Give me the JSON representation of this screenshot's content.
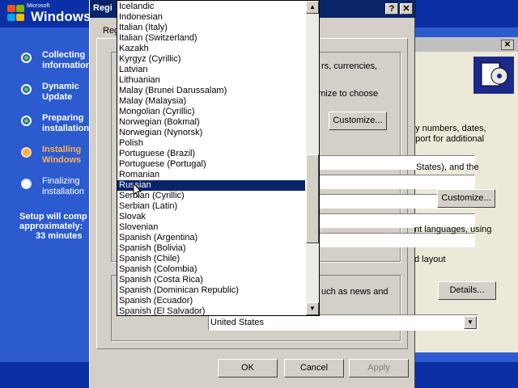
{
  "setup": {
    "logo_small": "Microsoft",
    "logo_text": "Windows",
    "steps": [
      {
        "label": "Collecting\ninformation",
        "state": "done"
      },
      {
        "label": "Dynamic\nUpdate",
        "state": "done"
      },
      {
        "label": "Preparing\ninstallation",
        "state": "done"
      },
      {
        "label": "Installing\nWindows",
        "state": "active"
      },
      {
        "label": "Finalizing\ninstallation",
        "state": "pending"
      }
    ],
    "time_line1": "Setup will comp",
    "time_line2": "approximately:",
    "time_line3": "33 minutes"
  },
  "dialog": {
    "title": "Regi",
    "tab_label": "Reg",
    "text_currencies": "rs, currencies,",
    "text_customize_to_choose": "omize to choose",
    "customize_button_1": "Customize...",
    "text_states": "States), and the",
    "text_languages_using": "nt languages, using",
    "text_layout": "d layout",
    "text_news": "uch as news and",
    "customize_button_2": "Customize...",
    "details_button": "Details...",
    "ok_button": "OK",
    "cancel_button": "Cancel",
    "apply_button": "Apply",
    "location_value": "United States"
  },
  "right_window": {
    "text_numbers": "ay numbers, dates,",
    "text_support": "pport for additional",
    "close_glyph": "✕"
  },
  "dropdown": {
    "items": [
      "Icelandic",
      "Indonesian",
      "Italian (Italy)",
      "Italian (Switzerland)",
      "Kazakh",
      "Kyrgyz (Cyrillic)",
      "Latvian",
      "Lithuanian",
      "Malay (Brunei Darussalam)",
      "Malay (Malaysia)",
      "Mongolian (Cyrillic)",
      "Norwegian (Bokmal)",
      "Norwegian (Nynorsk)",
      "Polish",
      "Portuguese (Brazil)",
      "Portuguese (Portugal)",
      "Romanian",
      "Russian",
      "Serbian (Cyrillic)",
      "Serbian (Latin)",
      "Slovak",
      "Slovenian",
      "Spanish (Argentina)",
      "Spanish (Bolivia)",
      "Spanish (Chile)",
      "Spanish (Colombia)",
      "Spanish (Costa Rica)",
      "Spanish (Dominican Republic)",
      "Spanish (Ecuador)",
      "Spanish (El Salvador)"
    ],
    "selected": "Russian"
  },
  "icons": {
    "help": "?",
    "close": "✕",
    "up": "▲",
    "down": "▼"
  },
  "colors": {
    "selection": "#0a246a",
    "setup_blue": "#2c5bd0"
  }
}
